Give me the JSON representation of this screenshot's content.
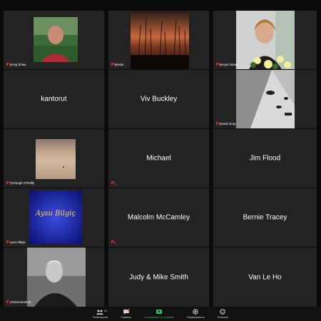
{
  "meeting": {
    "tiles": {
      "greg": {
        "name": "Greg Shaw"
      },
      "breda": {
        "name": "Breda"
      },
      "derya": {
        "name": "Derya Yazar"
      },
      "kantorut": {
        "name": "kantorut",
        "center": "kantorut"
      },
      "viv": {
        "name": "Viv Buckley",
        "center": "Viv Buckley"
      },
      "david": {
        "name": "David Gray"
      },
      "turlough": {
        "name": "Turlough O'Reilly"
      },
      "michael": {
        "name": "Michael",
        "center": "Michael"
      },
      "jim": {
        "name": "Jim Flood",
        "center": "Jim Flood"
      },
      "aysu": {
        "name": "Aysu Bilgic",
        "logo_text": "Aysu Bilgiç"
      },
      "malcolm": {
        "name": "Malcolm McCamley",
        "center": "Malcolm McCamley"
      },
      "bernie": {
        "name": "Bernie Tracey",
        "center": "Bernie Tracey"
      },
      "ahmet": {
        "name": "Ahmet Bozkurt"
      },
      "judy": {
        "name": "Judy & Mike Smith",
        "center": "Judy & Mike Smith"
      },
      "vanle": {
        "name": "Van Le Ho",
        "center": "Van Le Ho"
      }
    }
  },
  "toolbar": {
    "participants_label": "Partecipanti",
    "participants_count": "61",
    "chat_label": "Chattare",
    "share_label": "Condividere lo schermo",
    "record_label": "Registrazione",
    "reactions_label": "Reazioni",
    "accent_green": "#2fc15e",
    "mute_red": "#e0352b"
  }
}
